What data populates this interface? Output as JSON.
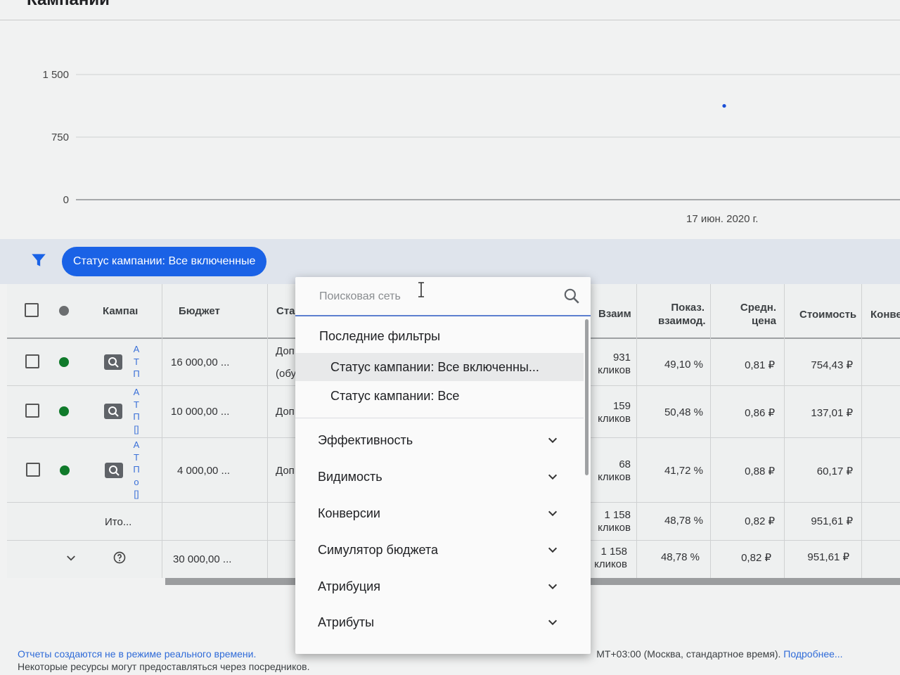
{
  "page": {
    "title": "Кампании"
  },
  "chart_data": {
    "type": "scatter",
    "y_ticks": [
      "1 500",
      "750",
      "0"
    ],
    "ylim": [
      0,
      1500
    ],
    "x_tick": "17 июн. 2020 г.",
    "points": [
      {
        "x": "17 июн. 2020 г.",
        "y": 1158
      }
    ],
    "grid": true,
    "color": "#1a4fd6"
  },
  "filter": {
    "chip_label": "Статус кампании: Все включенные"
  },
  "table": {
    "headers": {
      "campaign": "Кампаı",
      "budget": "Бюджет",
      "status": "Ста",
      "interactions": "Взаим",
      "interaction_rate": [
        "Показ.",
        "взаимод."
      ],
      "avg_cost": [
        "Средн.",
        "цена"
      ],
      "cost": "Стоимость",
      "conversions": "Конве"
    },
    "rows": [
      {
        "link_chars": [
          "А",
          "Т",
          "П"
        ],
        "budget": "16 000,00 ...",
        "status": [
          "Доп",
          "(обу"
        ],
        "interactions": [
          "931",
          "кликов"
        ],
        "rate": "49,10 %",
        "avg": "0,81 ₽",
        "cost": "754,43 ₽"
      },
      {
        "link_chars": [
          "А",
          "Т",
          "П",
          "[]"
        ],
        "budget": "10 000,00 ...",
        "status": [
          "Доп"
        ],
        "interactions": [
          "159",
          "кликов"
        ],
        "rate": "50,48 %",
        "avg": "0,86 ₽",
        "cost": "137,01 ₽"
      },
      {
        "link_chars": [
          "А",
          "Т",
          "П",
          "о",
          "[]"
        ],
        "budget": "4 000,00 ...",
        "status": [
          "Доп"
        ],
        "interactions": [
          "68",
          "кликов"
        ],
        "rate": "41,72 %",
        "avg": "0,88 ₽",
        "cost": "60,17 ₽"
      }
    ],
    "total": {
      "label": "Ито...",
      "interactions": [
        "1 158",
        "кликов"
      ],
      "rate": "48,78 %",
      "avg": "0,82 ₽",
      "cost": "951,61 ₽"
    },
    "grand_total": {
      "budget": "30 000,00 ...",
      "interactions": [
        "1 158",
        "кликов"
      ],
      "rate": "48,78 %",
      "avg": "0,82 ₽",
      "cost": "951,61 ₽"
    },
    "status_color": "#0f7a2a"
  },
  "dropdown": {
    "search_placeholder": "Поисковая сеть",
    "recent_title": "Последние фильтры",
    "recent": [
      "Статус кампании: Все включенны...",
      "Статус кампании: Все"
    ],
    "categories": [
      "Эффективность",
      "Видимость",
      "Конверсии",
      "Симулятор бюджета",
      "Атрибуция",
      "Атрибуты"
    ]
  },
  "footer": {
    "line1_blue": "Отчеты создаются не в режиме реального времени. ",
    "line1_dark": "MT+03:00 (Москва, стандартное время). ",
    "line1_link": "Подробнее...",
    "line2": "Некоторые ресурсы могут предоставляться через посредников."
  }
}
